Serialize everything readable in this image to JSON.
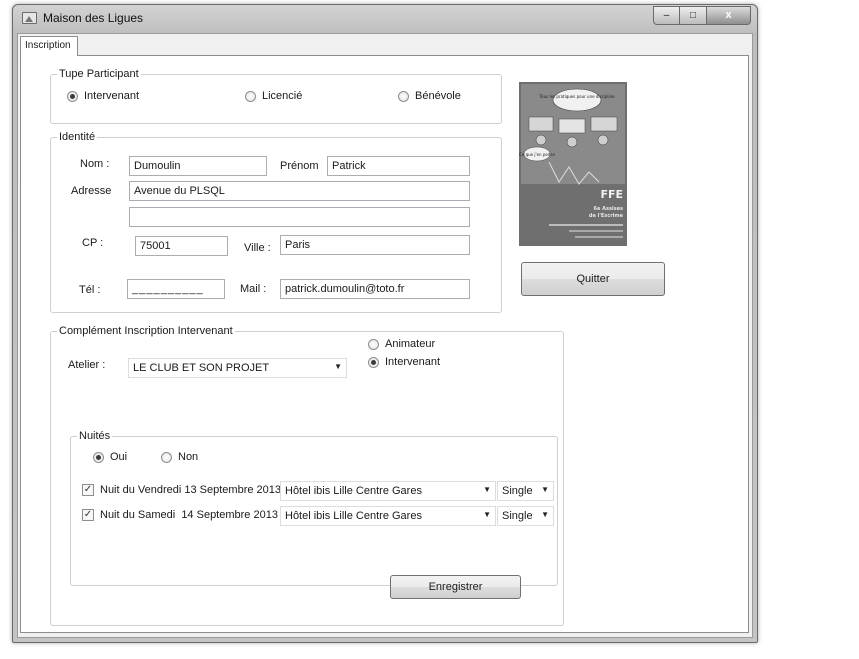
{
  "window": {
    "title": "Maison des Ligues",
    "controls": {
      "minimize": "–",
      "maximize": "□",
      "close": "x"
    }
  },
  "tab": {
    "label": "Inscription"
  },
  "type_participant": {
    "legend": "Tupe Participant",
    "options": [
      {
        "label": "Intervenant",
        "selected": true
      },
      {
        "label": "Licencié",
        "selected": false
      },
      {
        "label": "Bénévole",
        "selected": false
      }
    ]
  },
  "identite": {
    "legend": "Identité",
    "nom_label": "Nom :",
    "nom_value": "Dumoulin",
    "prenom_label": "Prénom",
    "prenom_value": "Patrick",
    "adresse_label": "Adresse",
    "adresse_line1": "Avenue du PLSQL",
    "adresse_line2": "",
    "cp_label": "CP :",
    "cp_value": "75001",
    "ville_label": "Ville :",
    "ville_value": "Paris",
    "tel_label": "Tél :",
    "tel_value": "_ _ _ _ _ _ _ _ _ _",
    "mail_label": "Mail :",
    "mail_value": "patrick.dumoulin@toto.fr"
  },
  "complement": {
    "legend": "Complément Inscription Intervenant",
    "atelier_label": "Atelier :",
    "atelier_value": "LE CLUB ET SON PROJET",
    "role_options": [
      {
        "label": "Animateur",
        "selected": false
      },
      {
        "label": "Intervenant",
        "selected": true
      }
    ]
  },
  "nuites": {
    "legend": "Nuités",
    "options": [
      {
        "label": "Oui",
        "selected": true
      },
      {
        "label": "Non",
        "selected": false
      }
    ],
    "nights": [
      {
        "label": "Nuit du Vendredi 13 Septembre 2013",
        "checked": true,
        "hotel": "Hôtel ibis Lille Centre Gares",
        "room": "Single"
      },
      {
        "label": "Nuit du Samedi  14 Septembre 2013",
        "checked": true,
        "hotel": "Hôtel ibis Lille Centre Gares",
        "room": "Single"
      }
    ]
  },
  "buttons": {
    "quitter": "Quitter",
    "enregistrer": "Enregistrer"
  },
  "poster": {
    "ffe": "FFE",
    "line1": "6e Assises",
    "line2": "de l'Escrime",
    "bubble1": "Tous les pratiques pour une discipline",
    "bubble2": "Ce que j'en pense"
  },
  "colors": {
    "title_bar": "#c8c8c8",
    "close_button": "#9b9b9b",
    "poster_bg": "#6f6f6f"
  }
}
